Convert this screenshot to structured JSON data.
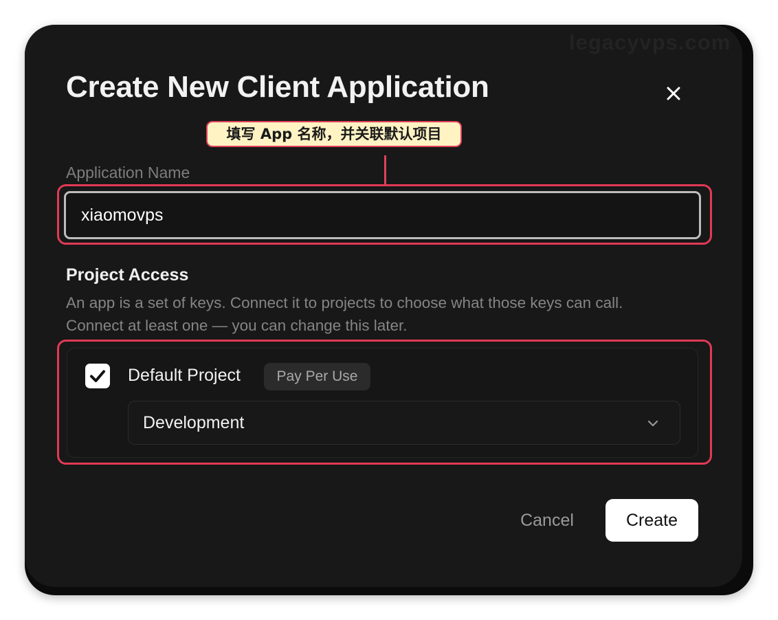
{
  "watermark": "legacyvps.com",
  "dialog": {
    "title": "Create New Client Application",
    "close_icon": "close-icon"
  },
  "annotation": {
    "text": "填写 App 名称，并关联默认项目",
    "highlight_color": "#e23a55",
    "bubble_color": "#fff3c4"
  },
  "app_name": {
    "label": "Application Name",
    "value": "xiaomovps"
  },
  "project_access": {
    "title": "Project Access",
    "description_lines": [
      "An app is a set of keys. Connect it to projects to choose what those keys can call.",
      "Connect at least one — you can change this later."
    ],
    "projects": [
      {
        "name": "Default Project",
        "plan": "Pay Per Use",
        "checked": true,
        "environment": "Development",
        "environment_icon": "chevron-down-icon"
      }
    ]
  },
  "actions": {
    "cancel_label": "Cancel",
    "create_label": "Create"
  }
}
